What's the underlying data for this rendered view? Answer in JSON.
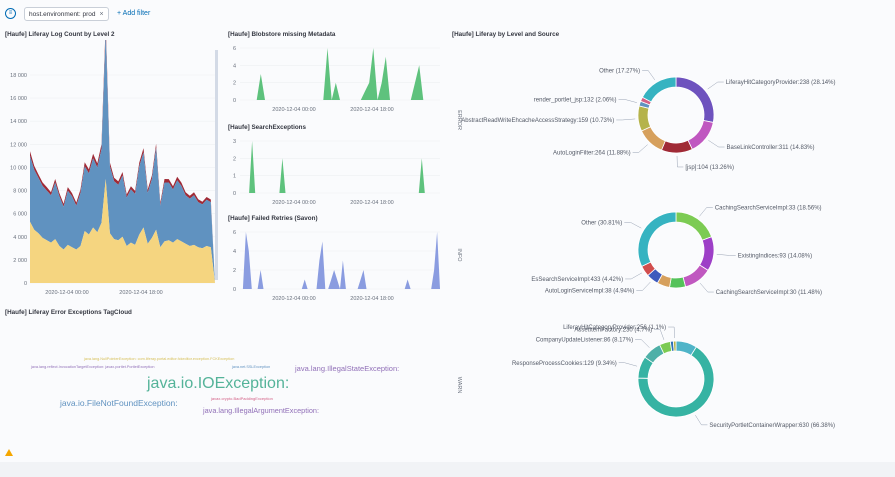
{
  "filter_bar": {
    "filter_pill": "host.environment: prod",
    "remove_symbol": "×",
    "add_filter": "+ Add filter"
  },
  "panels": {
    "log_count": {
      "title": "[Haufe] Liferay Log Count by Level 2",
      "y_ticks": [
        "0",
        "2 000",
        "4 000",
        "6 000",
        "8 000",
        "10 000",
        "12 000",
        "14 000",
        "16 000",
        "18 000"
      ],
      "x_ticks": [
        "2020-12-04 00:00",
        "2020-12-04 18:00"
      ]
    },
    "blobstore": {
      "title": "[Haufe] Blobstore missing Metadata",
      "y_ticks": [
        "0",
        "2",
        "4",
        "6"
      ],
      "x_ticks": [
        "2020-12-04 00:00",
        "2020-12-04 18:00"
      ]
    },
    "search_exceptions": {
      "title": "[Haufe] SearchExceptions",
      "y_ticks": [
        "0",
        "1",
        "2",
        "3"
      ],
      "x_ticks": [
        "2020-12-04 00:00",
        "2020-12-04 18:00"
      ]
    },
    "failed_retries": {
      "title": "[Haufe] Failed Retries (Savon)",
      "y_ticks": [
        "0",
        "2",
        "4",
        "6"
      ],
      "x_ticks": [
        "2020-12-04 00:00",
        "2020-12-04 18:00"
      ]
    },
    "tagcloud": {
      "title": "[Haufe] Liferay Error Exceptions TagCloud",
      "words": [
        {
          "text": "java.lang.NullPointerException: com.liferay.portal.editor.fckeditor.exception.FCKException",
          "color": "#d6bf57"
        },
        {
          "text": "java.lang.reflect.InvocationTargetException: javax.portlet.PortletException",
          "color": "#9170b8"
        },
        {
          "text": "java.net.SSLException",
          "color": "#6092c0"
        },
        {
          "text": "java.lang.IllegalStateException:",
          "color": "#9170b8"
        },
        {
          "text": "java.io.IOException:",
          "color": "#54b399"
        },
        {
          "text": "javax.crypto.BadPaddingException",
          "color": "#d36086"
        },
        {
          "text": "java.io.FileNotFoundException:",
          "color": "#6092c0"
        },
        {
          "text": "java.lang.IllegalArgumentException:",
          "color": "#9170b8"
        }
      ]
    },
    "level_source": {
      "title": "[Haufe] Liferay by Level and Source",
      "error": {
        "axis_label": "ERROR",
        "labels": [
          "Other (17.27%)",
          "render_portlet_jsp:132 (2.06%)",
          "AbstractReadWriteEhcacheAccessStrategy:159 (10.73%)",
          "AutoLoginFilter:264 (11.88%)",
          "LiferayHitCategoryProvider:238 (28.14%)",
          "BaseLinkController:311 (14.83%)",
          "[jsp]:104 (13.26%)"
        ]
      },
      "info": {
        "axis_label": "INFO",
        "labels": [
          "Other (30.81%)",
          "EsSearchServiceImpl:433 (4.42%)",
          "AutoLoginServiceImpl:38 (4.94%)",
          "CachingSearchServiceImpl:33 (18.56%)",
          "ExistingIndices:93 (14.08%)",
          "CachingSearchServiceImpl:30 (11.48%)"
        ]
      },
      "warn": {
        "axis_label": "WARN",
        "labels": [
          "LiferayHitCategoryProvider:256 (1.1%)",
          "AssetItemFactory:230 (4.7%)",
          "CompanyUpdateListener:86 (8.17%)",
          "ResponseProcessCookies:129 (9.34%)",
          "SecurityPortletContainerWrapper:630 (66.38%)"
        ]
      }
    }
  },
  "colors": {
    "green": "#54b399",
    "blue": "#6092c0",
    "cornflower": "#7b8fe0",
    "yellow": "#f5d580",
    "darkred": "#a02a36",
    "purple": "#6e52be",
    "magenta": "#c058c0",
    "tan": "#d6a05d",
    "teal": "#36b3c1",
    "olive": "#b5b34b",
    "lightgreen": "#7ccb53"
  },
  "chart_data": [
    {
      "type": "area",
      "title": "[Haufe] Liferay Log Count by Level 2",
      "ylim": [
        0,
        18000
      ],
      "x_ticks": [
        "2020-12-04 00:00",
        "2020-12-04 18:00"
      ],
      "series": [
        {
          "values": [
            5300,
            4600,
            4300,
            3900,
            3700,
            3500,
            3800,
            3200,
            2900,
            3300,
            3100,
            2900,
            3200,
            4500,
            4200,
            4800,
            4400,
            5200,
            9000,
            4300,
            3800,
            3700,
            4000,
            3200,
            3500,
            3300,
            4200,
            4800,
            3400,
            3900,
            4600,
            3100,
            3600,
            3700,
            3500,
            3800,
            3600,
            3400,
            3200,
            3300,
            3100,
            3000,
            3200,
            3100,
            0
          ]
        },
        {
          "values": [
            5700,
            5200,
            4800,
            4500,
            4300,
            4100,
            4900,
            4300,
            3700,
            4700,
            4400,
            3800,
            4600,
            5600,
            5300,
            6000,
            5600,
            6400,
            12800,
            5800,
            5000,
            4800,
            5300,
            4200,
            4600,
            4400,
            5900,
            6500,
            4400,
            5100,
            7100,
            3600,
            5100,
            5000,
            4600,
            5100,
            4800,
            4200,
            4100,
            4300,
            3900,
            3800,
            4000,
            3900,
            0
          ]
        },
        {
          "values": [
            400,
            350,
            300,
            300,
            300,
            250,
            300,
            280,
            260,
            300,
            280,
            260,
            300,
            350,
            330,
            380,
            350,
            400,
            700,
            330,
            300,
            290,
            310,
            260,
            280,
            270,
            330,
            370,
            280,
            300,
            350,
            230,
            300,
            290,
            280,
            300,
            290,
            260,
            250,
            260,
            240,
            230,
            240,
            230,
            0
          ]
        }
      ]
    },
    {
      "type": "area",
      "title": "[Haufe] Blobstore missing Metadata",
      "ylim": [
        0,
        6
      ],
      "x_ticks": [
        "2020-12-04 00:00",
        "2020-12-04 18:00"
      ],
      "values": [
        0,
        0,
        0,
        0,
        0,
        3,
        0,
        0,
        0,
        0,
        0,
        0,
        0,
        0,
        0,
        0,
        0,
        0,
        0,
        0,
        0,
        6,
        0,
        2,
        0,
        0,
        0,
        0,
        0,
        0,
        1,
        2,
        6,
        0,
        2,
        5,
        0,
        0,
        0,
        0,
        0,
        0,
        2,
        4,
        0,
        0,
        0,
        0,
        0
      ]
    },
    {
      "type": "area",
      "title": "[Haufe] SearchExceptions",
      "ylim": [
        0,
        3
      ],
      "x_ticks": [
        "2020-12-04 00:00",
        "2020-12-04 18:00"
      ],
      "values": [
        0,
        0,
        0,
        0,
        3,
        0,
        0,
        0,
        0,
        0,
        0,
        0,
        0,
        0,
        2,
        0,
        0,
        0,
        0,
        0,
        0,
        0,
        0,
        0,
        0,
        0,
        0,
        0,
        0,
        0,
        0,
        0,
        0,
        0,
        0,
        0,
        0,
        0,
        0,
        0,
        0,
        0,
        0,
        0,
        0,
        0,
        0,
        0,
        0,
        0,
        0,
        0,
        0,
        0,
        0,
        0,
        0,
        0,
        0,
        0,
        2,
        0,
        0,
        0,
        0,
        0,
        0
      ]
    },
    {
      "type": "area",
      "title": "[Haufe] Failed Retries (Savon)",
      "ylim": [
        0,
        6
      ],
      "x_ticks": [
        "2020-12-04 00:00",
        "2020-12-04 18:00"
      ],
      "values": [
        0,
        0,
        6,
        4,
        0,
        0,
        0,
        2,
        0,
        0,
        0,
        0,
        0,
        0,
        0,
        0,
        0,
        0,
        0,
        0,
        0,
        0,
        1,
        0,
        0,
        0,
        0,
        3,
        5,
        0,
        0,
        1,
        2,
        1,
        0,
        3,
        0,
        0,
        0,
        0,
        0,
        1,
        2,
        0,
        0,
        0,
        0,
        0,
        0,
        0,
        0,
        0,
        0,
        0,
        0,
        0,
        0,
        1,
        0,
        0,
        0,
        0,
        0,
        0,
        0,
        0,
        2,
        6,
        0
      ]
    },
    {
      "type": "pie",
      "subtitle": "ERROR",
      "slices": [
        {
          "label": "LiferayHitCategoryProvider:238 (28.14%)",
          "value": 28.14,
          "color": "#6e52be"
        },
        {
          "label": "BaseLinkController:311 (14.83%)",
          "value": 14.83,
          "color": "#c058c0"
        },
        {
          "label": "[jsp]:104 (13.26%)",
          "value": 13.26,
          "color": "#a02a36"
        },
        {
          "label": "AutoLoginFilter:264 (11.88%)",
          "value": 11.88,
          "color": "#d6a05d"
        },
        {
          "label": "AbstractReadWriteEhcacheAccessStrategy:159 (10.73%)",
          "value": 10.73,
          "color": "#b5b34b"
        },
        {
          "label": "render_portlet_jsp:132 (2.06%)",
          "value": 2.06,
          "color": "#6092c0"
        },
        {
          "label": "",
          "value": 1.83,
          "color": "#d36086"
        },
        {
          "label": "Other (17.27%)",
          "value": 17.27,
          "color": "#36b3c1"
        }
      ]
    },
    {
      "type": "pie",
      "subtitle": "INFO",
      "slices": [
        {
          "label": "CachingSearchServiceImpl:33 (18.56%)",
          "value": 18.56,
          "color": "#7ccb53"
        },
        {
          "label": "ExistingIndices:93 (14.08%)",
          "value": 14.08,
          "color": "#9d3fc7"
        },
        {
          "label": "CachingSearchServiceImpl:30 (11.48%)",
          "value": 11.48,
          "color": "#c058c0"
        },
        {
          "label": "",
          "value": 6.5,
          "color": "#54c25a"
        },
        {
          "label": "",
          "value": 5.2,
          "color": "#d6a05d"
        },
        {
          "label": "AutoLoginServiceImpl:38 (4.94%)",
          "value": 4.94,
          "color": "#3f5bbd"
        },
        {
          "label": "EsSearchServiceImpl:433 (4.42%)",
          "value": 4.42,
          "color": "#d14d4d"
        },
        {
          "label": "Other (30.81%)",
          "value": 30.81,
          "color": "#36b3c1"
        }
      ]
    },
    {
      "type": "pie",
      "subtitle": "WARN",
      "slices": [
        {
          "label": "",
          "value": 9.0,
          "color": "#4fb4c8"
        },
        {
          "label": "SecurityPortletContainerWrapper:630 (66.38%)",
          "value": 66.38,
          "color": "#36b3a3"
        },
        {
          "label": "ResponseProcessCookies:129 (9.34%)",
          "value": 9.34,
          "color": "#36b3a3"
        },
        {
          "label": "CompanyUpdateListener:86 (8.17%)",
          "value": 8.17,
          "color": "#4fb0a8"
        },
        {
          "label": "AssetItemFactory:230 (4.7%)",
          "value": 4.7,
          "color": "#7ccb53"
        },
        {
          "label": "",
          "value": 1.3,
          "color": "#2d6fb6"
        },
        {
          "label": "LiferayHitCategoryProvider:256 (1.1%)",
          "value": 1.1,
          "color": "#b5b34b"
        }
      ]
    }
  ]
}
